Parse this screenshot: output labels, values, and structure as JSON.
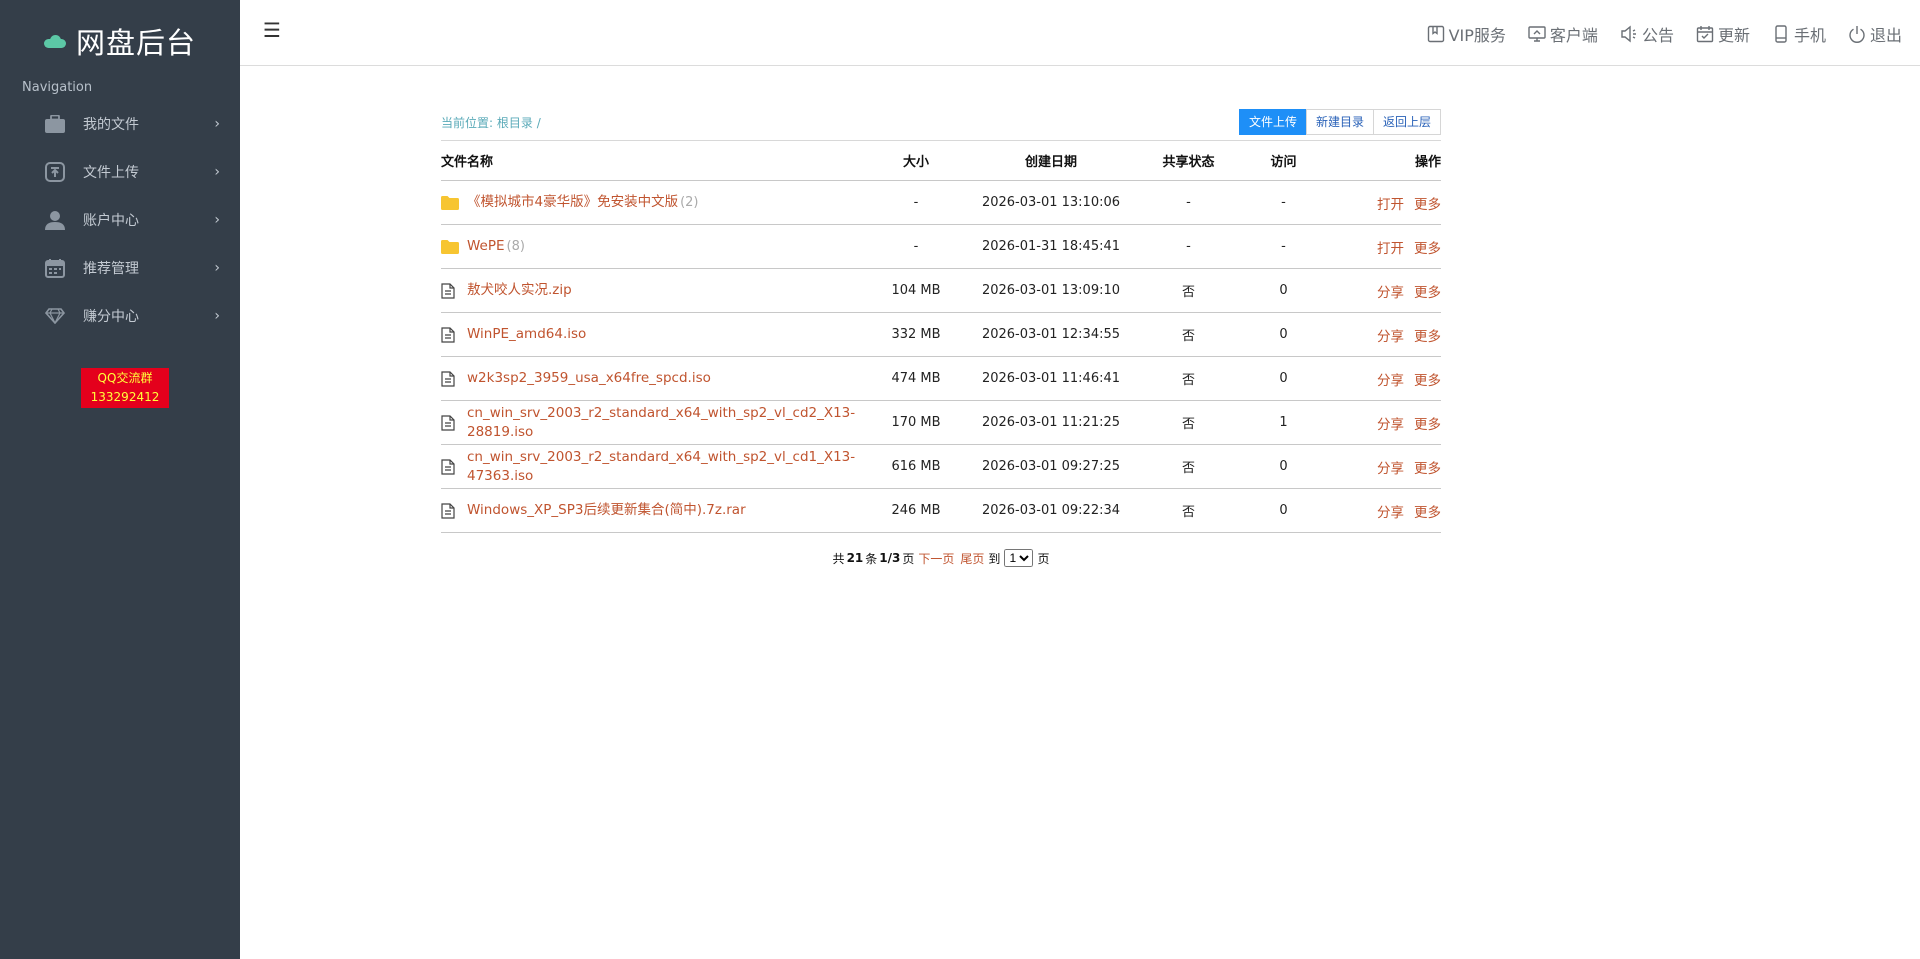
{
  "sidebar": {
    "brand_title": "网盘后台",
    "caption": "Navigation",
    "items": [
      {
        "label": "我的文件",
        "icon": "briefcase-icon"
      },
      {
        "label": "文件上传",
        "icon": "upload-icon"
      },
      {
        "label": "账户中心",
        "icon": "user-icon"
      },
      {
        "label": "推荐管理",
        "icon": "calendar-icon"
      },
      {
        "label": "赚分中心",
        "icon": "diamond-icon"
      }
    ],
    "qq_group_line1": "QQ交流群",
    "qq_group_line2": "133292412"
  },
  "topbar": {
    "menu_icon": "☰",
    "items": [
      {
        "label": "VIP服务",
        "icon": "bookmark-icon"
      },
      {
        "label": "客户端",
        "icon": "monitor-icon"
      },
      {
        "label": "公告",
        "icon": "megaphone-icon"
      },
      {
        "label": "更新",
        "icon": "calendar-check-icon"
      },
      {
        "label": "手机",
        "icon": "phone-icon"
      },
      {
        "label": "退出",
        "icon": "power-icon"
      }
    ]
  },
  "breadcrumb": {
    "prefix": "当前位置:",
    "root": "根目录",
    "sep": "/"
  },
  "actions": {
    "upload": "文件上传",
    "new_folder": "新建目录",
    "go_up": "返回上层"
  },
  "table": {
    "headers": {
      "name": "文件名称",
      "size": "大小",
      "date": "创建日期",
      "share": "共享状态",
      "visit": "访问",
      "ops": "操作"
    },
    "rows": [
      {
        "type": "folder",
        "name": "《模拟城市4豪华版》免安装中文版",
        "count": "(2)",
        "size": "-",
        "date": "2026-03-01 13:10:06",
        "share": "-",
        "visit": "-",
        "op1": "打开",
        "op2": "更多"
      },
      {
        "type": "folder",
        "name": "WePE",
        "count": "(8)",
        "size": "-",
        "date": "2026-01-31 18:45:41",
        "share": "-",
        "visit": "-",
        "op1": "打开",
        "op2": "更多"
      },
      {
        "type": "file",
        "name": "敖犬咬人实况.zip",
        "count": "",
        "size": "104 MB",
        "date": "2026-03-01 13:09:10",
        "share": "否",
        "visit": "0",
        "op1": "分享",
        "op2": "更多"
      },
      {
        "type": "file",
        "name": "WinPE_amd64.iso",
        "count": "",
        "size": "332 MB",
        "date": "2026-03-01 12:34:55",
        "share": "否",
        "visit": "0",
        "op1": "分享",
        "op2": "更多"
      },
      {
        "type": "file",
        "name": "w2k3sp2_3959_usa_x64fre_spcd.iso",
        "count": "",
        "size": "474 MB",
        "date": "2026-03-01 11:46:41",
        "share": "否",
        "visit": "0",
        "op1": "分享",
        "op2": "更多"
      },
      {
        "type": "file",
        "name": "cn_win_srv_2003_r2_standard_x64_with_sp2_vl_cd2_X13-28819.iso",
        "count": "",
        "size": "170 MB",
        "date": "2026-03-01 11:21:25",
        "share": "否",
        "visit": "1",
        "op1": "分享",
        "op2": "更多"
      },
      {
        "type": "file",
        "name": "cn_win_srv_2003_r2_standard_x64_with_sp2_vl_cd1_X13-47363.iso",
        "count": "",
        "size": "616 MB",
        "date": "2026-03-01 09:27:25",
        "share": "否",
        "visit": "0",
        "op1": "分享",
        "op2": "更多"
      },
      {
        "type": "file",
        "name": "Windows_XP_SP3后续更新集合(简中).7z.rar",
        "count": "",
        "size": "246 MB",
        "date": "2026-03-01 09:22:34",
        "share": "否",
        "visit": "0",
        "op1": "分享",
        "op2": "更多"
      }
    ]
  },
  "pager": {
    "total_prefix": "共",
    "total": "21",
    "total_suffix": "条",
    "page": "1/3",
    "page_suffix": "页",
    "next": "下一页",
    "last": "尾页",
    "goto_prefix": "到",
    "goto_value": "1",
    "goto_suffix": "页"
  },
  "colors": {
    "sidebar_bg": "#343e49",
    "link": "#c0542f",
    "primary_button": "#1e8ff7",
    "folder": "#f7c531",
    "qq_badge_bg": "#e4001c",
    "qq_badge_text": "#ffff3a"
  }
}
